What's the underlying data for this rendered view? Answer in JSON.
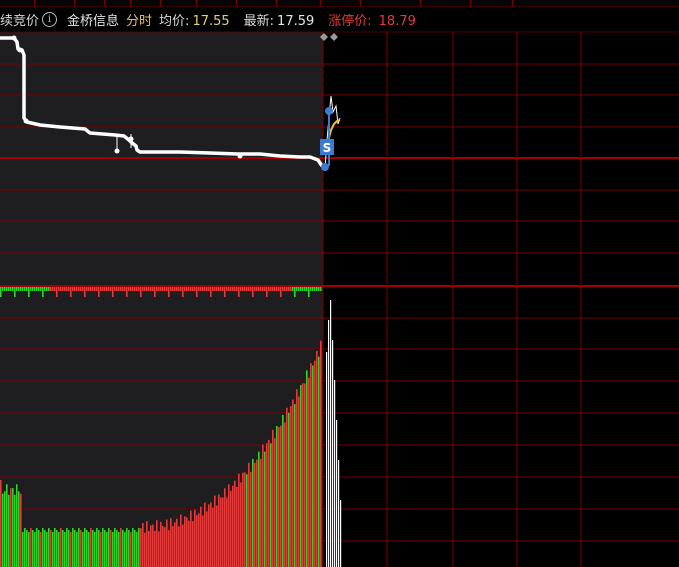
{
  "header": {
    "auction_label": "续竞价",
    "info_icon": "i",
    "stock_name": "金桥信息",
    "mode_tab": "分时",
    "avg_price_label": "均价:",
    "avg_price_value": "17.55",
    "latest_label": "最新:",
    "latest_value": "17.59",
    "limit_label": "涨停价:",
    "limit_value": "18.79"
  },
  "chart": {
    "sell_marker": "S",
    "colors": {
      "grid": "#7a0000",
      "price_line": "#ffffff",
      "avg_line": "#e8c23a",
      "volume_up": "#e23b3b",
      "volume_down": "#2ed12e",
      "marker": "#3d7bd1"
    }
  }
}
